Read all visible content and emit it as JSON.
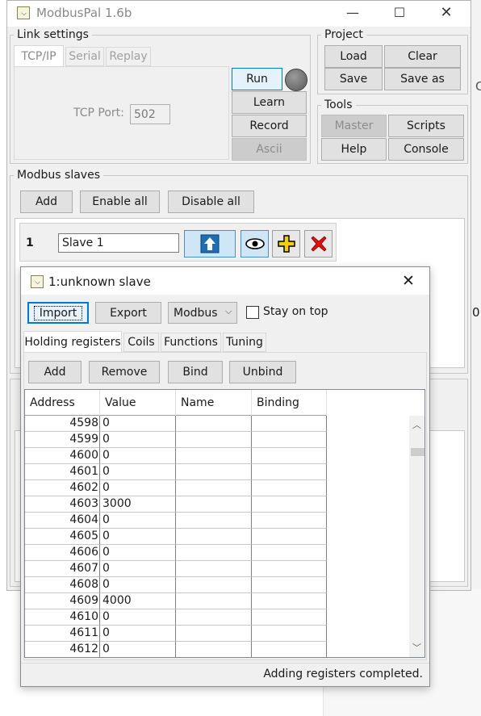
{
  "main_window": {
    "title": "ModbusPal 1.6b",
    "controls": {
      "minimize": "—",
      "maximize": "☐",
      "close": "✕"
    }
  },
  "link_settings": {
    "legend": "Link settings",
    "tabs": [
      "TCP/IP",
      "Serial",
      "Replay"
    ],
    "tcp_port_label": "TCP Port:",
    "tcp_port_value": "502",
    "buttons": {
      "run": "Run",
      "learn": "Learn",
      "record": "Record",
      "ascii": "Ascii"
    }
  },
  "project": {
    "legend": "Project",
    "buttons": {
      "load": "Load",
      "clear": "Clear",
      "save": "Save",
      "save_as": "Save as"
    }
  },
  "tools": {
    "legend": "Tools",
    "buttons": {
      "master": "Master",
      "scripts": "Scripts",
      "help": "Help",
      "console": "Console"
    }
  },
  "modbus_slaves": {
    "legend": "Modbus slaves",
    "buttons": {
      "add": "Add",
      "enable_all": "Enable all",
      "disable_all": "Disable all"
    },
    "slave": {
      "id": "1",
      "name": "Slave 1"
    }
  },
  "dialog": {
    "title": "1:unknown slave",
    "close": "✕",
    "toolbar": {
      "import": "Import",
      "export": "Export",
      "protocol": "Modbus",
      "stay_on_top": "Stay on top"
    },
    "tabs": [
      "Holding registers",
      "Coils",
      "Functions",
      "Tuning"
    ],
    "actions": {
      "add": "Add",
      "remove": "Remove",
      "bind": "Bind",
      "unbind": "Unbind"
    },
    "table": {
      "columns": [
        "Address",
        "Value",
        "Name",
        "Binding"
      ],
      "rows": [
        {
          "address": "4598",
          "value": "0"
        },
        {
          "address": "4599",
          "value": "0"
        },
        {
          "address": "4600",
          "value": "0"
        },
        {
          "address": "4601",
          "value": "0"
        },
        {
          "address": "4602",
          "value": "0"
        },
        {
          "address": "4603",
          "value": "3000"
        },
        {
          "address": "4604",
          "value": "0"
        },
        {
          "address": "4605",
          "value": "0"
        },
        {
          "address": "4606",
          "value": "0"
        },
        {
          "address": "4607",
          "value": "0"
        },
        {
          "address": "4608",
          "value": "0"
        },
        {
          "address": "4609",
          "value": "4000"
        },
        {
          "address": "4610",
          "value": "0"
        },
        {
          "address": "4611",
          "value": "0"
        },
        {
          "address": "4612",
          "value": "0"
        }
      ]
    },
    "status": "Adding registers completed."
  },
  "background_fragments": {
    "digit": "0",
    "letter": "C"
  }
}
